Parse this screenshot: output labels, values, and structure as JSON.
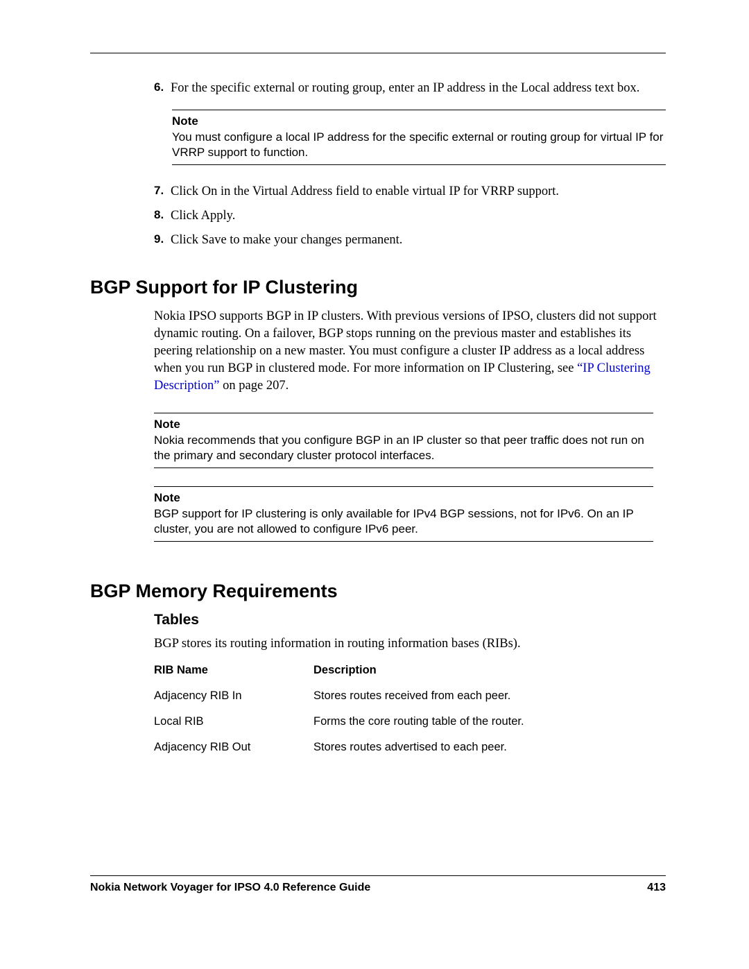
{
  "steps_group1": [
    {
      "num": "6.",
      "text": "For the specific external or routing group, enter an IP address in the Local address text box."
    }
  ],
  "note1": {
    "label": "Note",
    "text": "You must configure a local IP address for the specific external or routing group for virtual IP for VRRP support to function."
  },
  "steps_group2": [
    {
      "num": "7.",
      "text": "Click On in the Virtual Address field to enable virtual IP for VRRP support."
    },
    {
      "num": "8.",
      "text": "Click Apply."
    },
    {
      "num": "9.",
      "text": "Click Save to make your changes permanent."
    }
  ],
  "section1": {
    "heading": "BGP Support for IP Clustering",
    "para_pre": "Nokia IPSO supports BGP in IP clusters. With previous versions of IPSO, clusters did not support dynamic routing. On a failover, BGP stops running on the previous master and establishes its peering relationship on a new master. You must configure a cluster IP address as a local address when you run BGP in clustered mode. For more information on IP Clustering, see ",
    "link": "“IP Clustering Description”",
    "para_post": " on page 207."
  },
  "note2": {
    "label": "Note",
    "text": "Nokia recommends that you configure BGP in an IP cluster so that peer traffic does not run on the primary and secondary cluster protocol interfaces."
  },
  "note3": {
    "label": "Note",
    "text": "BGP support for IP clustering is only available for IPv4 BGP sessions, not for IPv6. On an IP cluster, you are not allowed to configure IPv6 peer."
  },
  "section2": {
    "heading": "BGP Memory Requirements",
    "subheading": "Tables",
    "para": "BGP stores its routing information in routing information bases (RIBs)."
  },
  "rib_table": {
    "head": {
      "c1": "RIB Name",
      "c2": "Description"
    },
    "rows": [
      {
        "c1": "Adjacency RIB In",
        "c2": "Stores routes received from each peer."
      },
      {
        "c1": "Local RIB",
        "c2": "Forms the core routing table of the router."
      },
      {
        "c1": "Adjacency RIB Out",
        "c2": "Stores routes advertised to each peer."
      }
    ]
  },
  "footer": {
    "title": "Nokia Network Voyager for IPSO 4.0 Reference Guide",
    "page": "413"
  }
}
